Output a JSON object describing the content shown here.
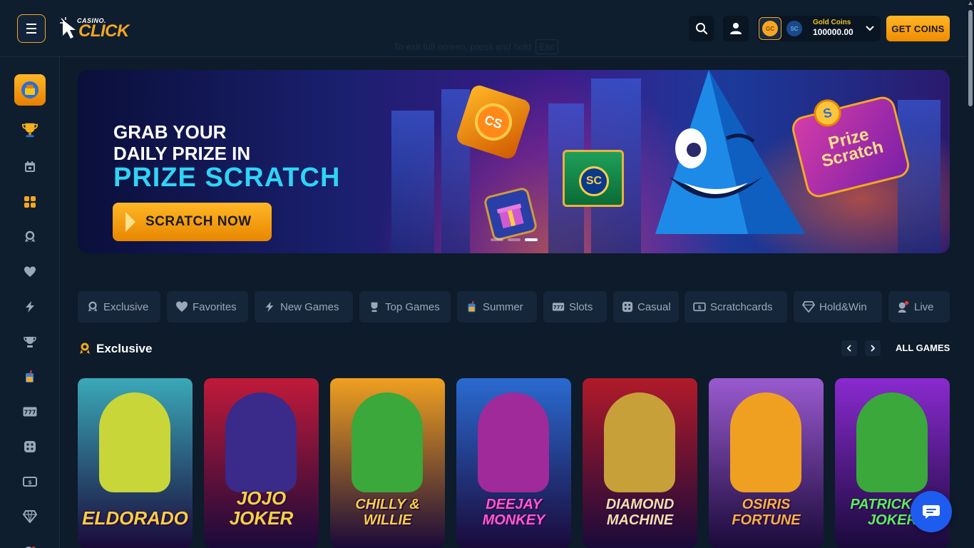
{
  "header": {
    "logo_small": "CASINO.",
    "logo_big": "CLICK",
    "fullscreen_hint": "To exit full screen, press and hold",
    "fullscreen_key": "Esc",
    "wallet": {
      "gc_label": "GC",
      "sc_label": "SC",
      "currency": "Gold Coins",
      "amount": "100000.00"
    },
    "get_coins": "GET COINS"
  },
  "banner": {
    "line1": "GRAB YOUR",
    "line2": "DAILY PRIZE IN",
    "highlight": "PRIZE SCRATCH",
    "cta": "SCRATCH NOW",
    "coin_label": "CS",
    "gift_label": "SC",
    "badge_line1": "Prize",
    "badge_line2": "Scratch",
    "badge_coin": "S"
  },
  "categories": [
    {
      "label": "Exclusive",
      "icon": "award-icon"
    },
    {
      "label": "Favorites",
      "icon": "heart-icon"
    },
    {
      "label": "New Games",
      "icon": "bolt-icon"
    },
    {
      "label": "Top Games",
      "icon": "trophy-icon"
    },
    {
      "label": "Summer",
      "icon": "drink-icon"
    },
    {
      "label": "Slots",
      "icon": "slots-icon"
    },
    {
      "label": "Casual",
      "icon": "dice-icon"
    },
    {
      "label": "Scratchcards",
      "icon": "ticket-icon"
    },
    {
      "label": "Hold&Win",
      "icon": "diamond-icon"
    },
    {
      "label": "Live",
      "icon": "live-icon"
    }
  ],
  "section": {
    "title": "Exclusive",
    "all_games": "ALL GAMES"
  },
  "games": [
    {
      "title": "ELDORADO",
      "bg": "#3aa8b8",
      "accent": "#c8d63a",
      "text": "#f5d23a"
    },
    {
      "title": "JOJO JOKER",
      "bg": "#c01a3a",
      "accent": "#3a2a8a",
      "text": "#f5d23a"
    },
    {
      "title": "CHILLY & WILLIE",
      "bg": "#f0a020",
      "accent": "#3aa83a",
      "text": "#f5d23a"
    },
    {
      "title": "DeeJay MONKEY",
      "bg": "#2a6ad0",
      "accent": "#a02a9a",
      "text": "#ff5ad0"
    },
    {
      "title": "DIAMOND MACHINE",
      "bg": "#b01a2a",
      "accent": "#c8a03a",
      "text": "#f5e0a0"
    },
    {
      "title": "OSIRIS FORTUNE",
      "bg": "#9a5ad0",
      "accent": "#f0a020",
      "text": "#f5b23a"
    },
    {
      "title": "PATRICK VS JOKER",
      "bg": "#8a2ad0",
      "accent": "#3aa83a",
      "text": "#5af05a"
    }
  ]
}
